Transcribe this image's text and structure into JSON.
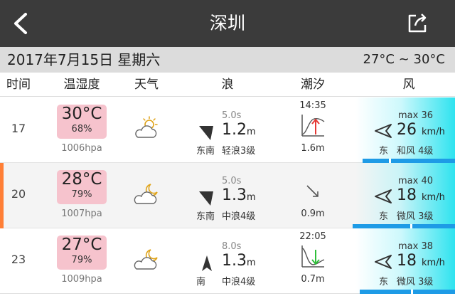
{
  "header": {
    "title": "深圳"
  },
  "date_bar": {
    "date": "2017年7月15日  星期六",
    "temp_range": "27°C ~ 30°C"
  },
  "columns": [
    "时间",
    "温湿度",
    "天气",
    "浪",
    "潮汐",
    "风"
  ],
  "rows": [
    {
      "time": "17",
      "temp": "30°C",
      "humidity": "68%",
      "pressure": "1006hpa",
      "weather_icon": "sun-behind-cloud-icon",
      "wave_period": "5.0s",
      "wave_height": "1.2",
      "wave_unit": "m",
      "wave_dir": "东南",
      "wave_level": "轻浪3级",
      "tide_time": "14:35",
      "tide_icon": "tide-rising-icon",
      "tide_height": "1.6m",
      "wind_max": "max 36",
      "wind_speed": "26",
      "wind_unit": "km/h",
      "wind_dir": "东",
      "wind_level": "和风 4级"
    },
    {
      "time": "20",
      "temp": "28°C",
      "humidity": "79%",
      "pressure": "1007hpa",
      "weather_icon": "moon-behind-cloud-icon",
      "wave_period": "5.0s",
      "wave_height": "1.3",
      "wave_unit": "m",
      "wave_dir": "东南",
      "wave_level": "中浪4级",
      "tide_time": "",
      "tide_icon": "tide-falling-arrow-icon",
      "tide_height": "0.9m",
      "wind_max": "max 40",
      "wind_speed": "18",
      "wind_unit": "km/h",
      "wind_dir": "东",
      "wind_level": "微风 3级"
    },
    {
      "time": "23",
      "temp": "27°C",
      "humidity": "79%",
      "pressure": "1009hpa",
      "weather_icon": "moon-behind-cloud-icon",
      "wave_period": "8.0s",
      "wave_height": "1.3",
      "wave_unit": "m",
      "wave_dir": "南",
      "wave_level": "中浪4级",
      "tide_time": "22:05",
      "tide_icon": "tide-low-icon",
      "tide_height": "0.7m",
      "wind_max": "max 38",
      "wind_speed": "18",
      "wind_unit": "km/h",
      "wind_dir": "东",
      "wind_level": "微风 3级"
    }
  ],
  "colors": {
    "topbar": "#3b3b3b",
    "temp_box": "#f6c3cd",
    "tide_rise": "#e53935",
    "tide_low": "#2fbf3a",
    "wind_bar": "#1e9be6",
    "row_marker": "#ff7f36"
  }
}
